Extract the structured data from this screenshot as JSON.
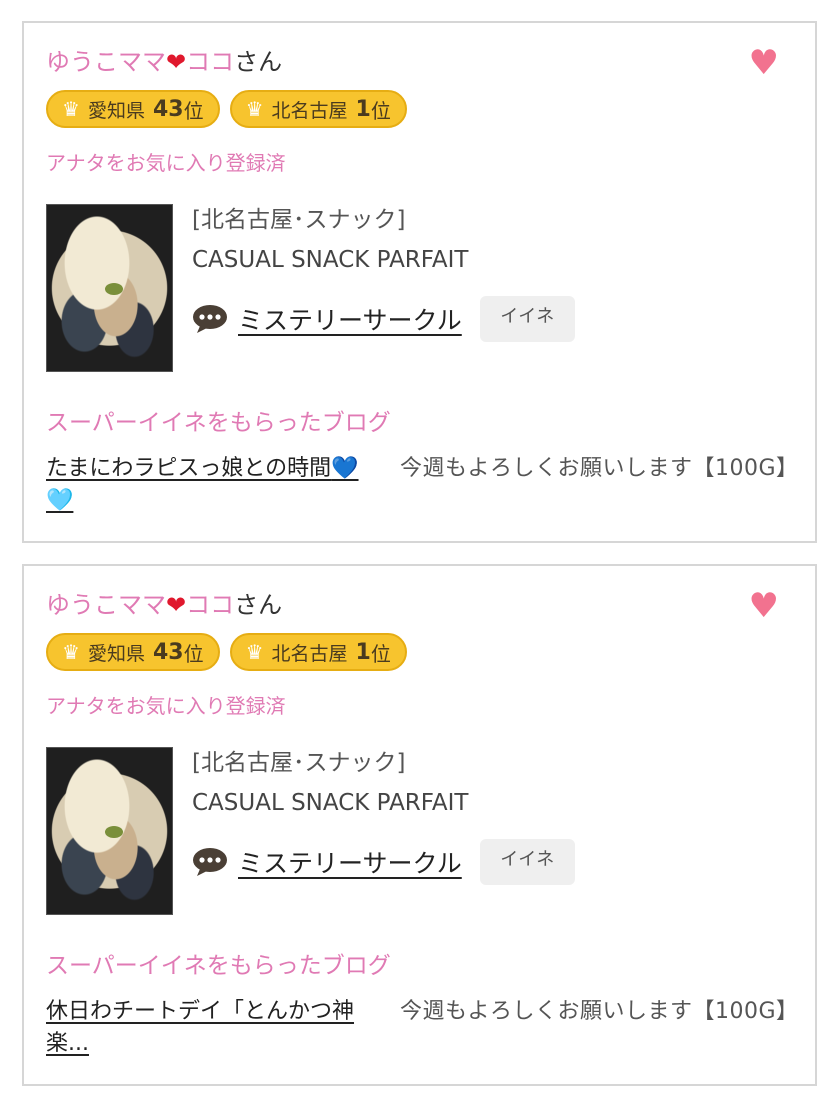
{
  "cards": [
    {
      "cast_name": "ゆうこママ",
      "cast_heart": "❤",
      "cast_name_suffix": "ココ",
      "honorific": "さん",
      "favorite_icon": "heart-icon",
      "ranks": [
        {
          "area": "愛知県",
          "number": "43",
          "unit": "位"
        },
        {
          "area": "北名古屋",
          "number": "1",
          "unit": "位"
        }
      ],
      "favorite_status": "アナタをお気に入り登録済",
      "shop_area": "[北名古屋･スナック]",
      "shop_name": "CASUAL SNACK PARFAIT",
      "circle_name": "ミステリーサークル",
      "like_label": "イイネ",
      "blog_section_title": "スーパーイイネをもらったブログ",
      "blog_title": "たまにわラピスっ娘との時間",
      "blog_title_hearts": "💙🩵",
      "blog_comment": "今週もよろしくお願いします【100G】"
    },
    {
      "cast_name": "ゆうこママ",
      "cast_heart": "❤",
      "cast_name_suffix": "ココ",
      "honorific": "さん",
      "favorite_icon": "heart-icon",
      "ranks": [
        {
          "area": "愛知県",
          "number": "43",
          "unit": "位"
        },
        {
          "area": "北名古屋",
          "number": "1",
          "unit": "位"
        }
      ],
      "favorite_status": "アナタをお気に入り登録済",
      "shop_area": "[北名古屋･スナック]",
      "shop_name": "CASUAL SNACK PARFAIT",
      "circle_name": "ミステリーサークル",
      "like_label": "イイネ",
      "blog_section_title": "スーパーイイネをもらったブログ",
      "blog_title": "休日わチートデイ「とんかつ神楽...",
      "blog_title_hearts": "",
      "blog_comment": "今週もよろしくお願いします【100G】"
    }
  ],
  "colors": {
    "pink": "#e07ab4",
    "favorite_heart": "#f2728f",
    "rank_badge": "#f7c42e"
  }
}
